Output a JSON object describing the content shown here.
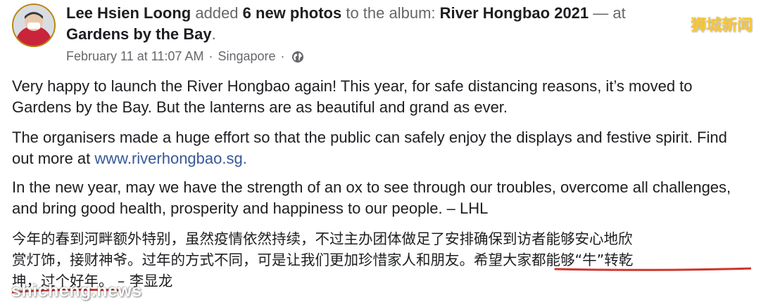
{
  "post": {
    "author": "Lee Hsien Loong",
    "action_text_1": " added ",
    "photo_count_text": "6 new photos",
    "action_text_2": " to the album: ",
    "album_name": "River Hongbao 2021",
    "location_prefix": " — at",
    "location_name": "Gardens by the Bay",
    "location_suffix": ".",
    "date": "February 11 at 11:07 AM",
    "separator": "·",
    "place": "Singapore",
    "paragraph_1": "Very happy to launch the River Hongbao again! This year, for safe distancing reasons, it’s moved to Gardens by the Bay. But the lanterns are as beautiful and grand as ever.",
    "paragraph_2_text": "The organisers made a huge effort so that the public can safely enjoy the displays and festive spirit. Find out more at ",
    "paragraph_2_link": "www.riverhongbao.sg.",
    "paragraph_3": "In the new year, may we have the strength of an ox to see through our troubles, overcome all challenges, and bring good health, prosperity and happiness to our people. – LHL",
    "paragraph_4_line_1": "今年的春到河畔额外特别，虽然疫情依然持续，不过主办团体做足了安排确保到访者能够安心地欣",
    "paragraph_4_line_2": "赏灯饰，接财神爷。过年的方式不同，可是让我们更加珍惜家人和朋友。希望大家都能够“牛”转乾",
    "paragraph_4_line_3": "坤，过个好年。 – 李显龙"
  },
  "watermarks": {
    "top_right": "狮城新闻",
    "bottom_left": "shicheng.news"
  },
  "icons": {
    "privacy": "globe-icon",
    "avatar": "profile-photo"
  },
  "colors": {
    "link": "#385898",
    "secondary_text": "#65676b",
    "underline": "#d0342c"
  }
}
